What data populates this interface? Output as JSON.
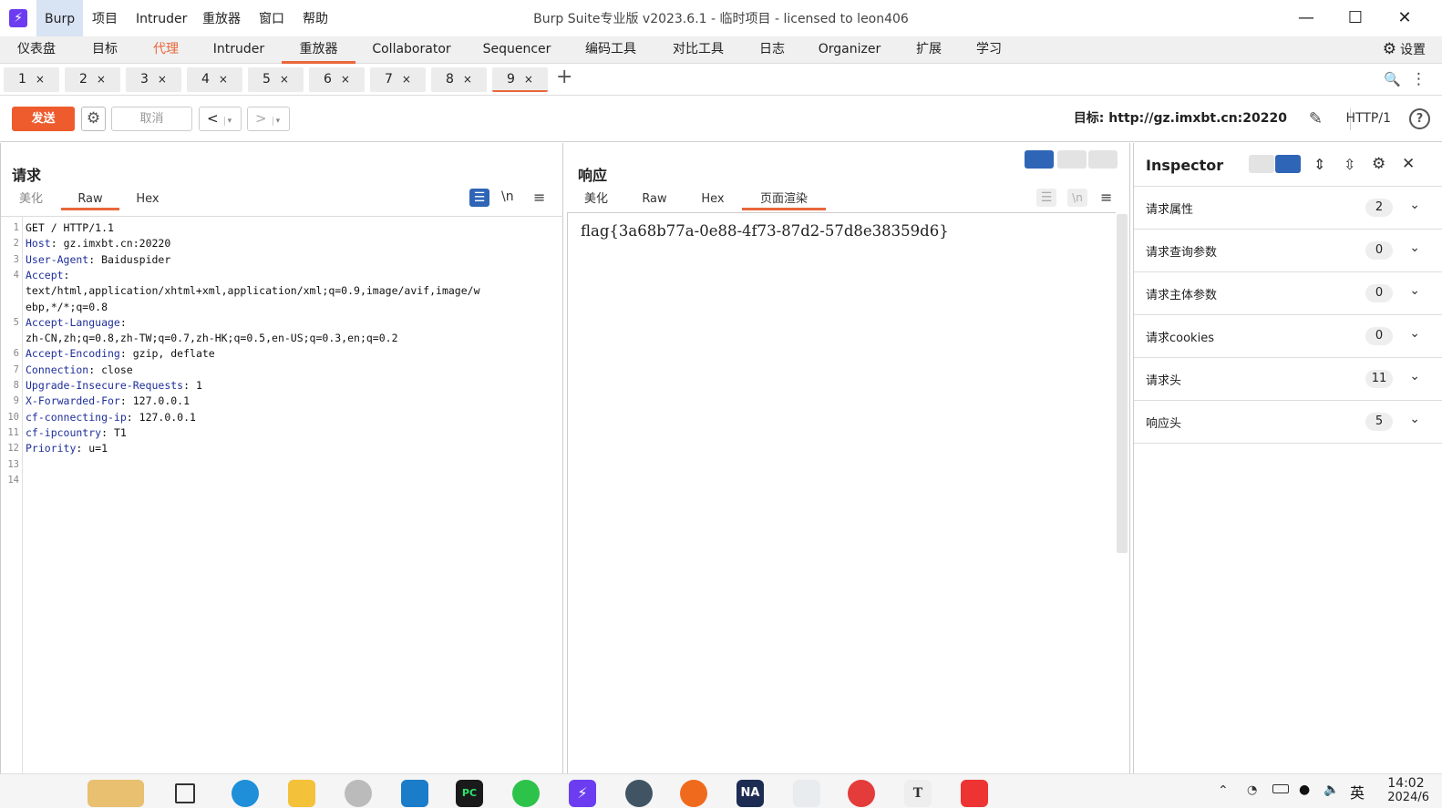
{
  "titlebar": {
    "app_logo": "⚡",
    "menu": [
      "Burp",
      "项目",
      "Intruder",
      "重放器",
      "窗口",
      "帮助"
    ],
    "window_title": "Burp Suite专业版  v2023.6.1 - 临时项目 - licensed to leon406",
    "minimize": "—",
    "maximize": "☐",
    "close": "✕"
  },
  "main_tabs": [
    "仪表盘",
    "目标",
    "代理",
    "Intruder",
    "重放器",
    "Collaborator",
    "Sequencer",
    "编码工具",
    "对比工具",
    "日志",
    "Organizer",
    "扩展",
    "学习"
  ],
  "settings_label": "设置",
  "settings_icon": "⚙",
  "repeater_tabs": [
    "1",
    "2",
    "3",
    "4",
    "5",
    "6",
    "7",
    "8",
    "9"
  ],
  "repeater_tab_close": "×",
  "add_tab": "+",
  "search_icon": "🔍",
  "more_icon": "⋮",
  "toolbar": {
    "send": "发送",
    "send_settings_icon": "⚙",
    "cancel": "取消",
    "back": "<",
    "forward": ">",
    "dropdown": "▾",
    "target_label": "目标: http://gz.imxbt.cn:20220",
    "edit_icon": "✎",
    "http_version": "HTTP/1",
    "help_icon": "?"
  },
  "request": {
    "title": "请求",
    "tabs": [
      "美化",
      "Raw",
      "Hex"
    ],
    "active_tab": "Raw",
    "tool_icons": [
      "☰",
      "\\n",
      "≡"
    ],
    "lines": [
      {
        "n": "1",
        "key": "",
        "val": "GET / HTTP/1.1"
      },
      {
        "n": "2",
        "key": "Host",
        "val": " gz.imxbt.cn:20220"
      },
      {
        "n": "3",
        "key": "User-Agent",
        "val": " Baiduspider"
      },
      {
        "n": "4",
        "key": "Accept",
        "val": ""
      },
      {
        "n": "",
        "key": "",
        "val": "text/html,application/xhtml+xml,application/xml;q=0.9,image/avif,image/w"
      },
      {
        "n": "",
        "key": "",
        "val": "ebp,*/*;q=0.8"
      },
      {
        "n": "5",
        "key": "Accept-Language",
        "val": ""
      },
      {
        "n": "",
        "key": "",
        "val": "zh-CN,zh;q=0.8,zh-TW;q=0.7,zh-HK;q=0.5,en-US;q=0.3,en;q=0.2"
      },
      {
        "n": "6",
        "key": "Accept-Encoding",
        "val": " gzip, deflate"
      },
      {
        "n": "7",
        "key": "Connection",
        "val": " close"
      },
      {
        "n": "8",
        "key": "Upgrade-Insecure-Requests",
        "val": " 1"
      },
      {
        "n": "9",
        "key": "X-Forwarded-For",
        "val": " 127.0.0.1"
      },
      {
        "n": "10",
        "key": "cf-connecting-ip",
        "val": " 127.0.0.1"
      },
      {
        "n": "11",
        "key": "cf-ipcountry",
        "val": " T1"
      },
      {
        "n": "12",
        "key": "Priority",
        "val": " u=1"
      },
      {
        "n": "13",
        "key": "",
        "val": ""
      },
      {
        "n": "14",
        "key": "",
        "val": ""
      }
    ]
  },
  "response": {
    "title": "响应",
    "tabs": [
      "美化",
      "Raw",
      "Hex",
      "页面渲染"
    ],
    "active_tab": "页面渲染",
    "tool_icons": [
      "☰",
      "\\n",
      "≡"
    ],
    "body": "flag{3a68b77a-0e88-4f73-87d2-57d8e38359d6}"
  },
  "inspector": {
    "title": "Inspector",
    "icons": [
      "⇕",
      "⇳",
      "⚙",
      "✕"
    ],
    "rows": [
      {
        "label": "请求属性",
        "count": "2"
      },
      {
        "label": "请求查询参数",
        "count": "0"
      },
      {
        "label": "请求主体参数",
        "count": "0"
      },
      {
        "label": "请求cookies",
        "count": "0"
      },
      {
        "label": "请求头",
        "count": "11"
      },
      {
        "label": "响应头",
        "count": "5"
      }
    ],
    "chevron": "⌄"
  },
  "taskbar": {
    "tray_ime": "英",
    "clock": "14:02",
    "date": "2024/6",
    "na_label": "NA",
    "pc_label": "PC",
    "t_label": "T"
  },
  "colors": {
    "accent": "#e9673b",
    "send_button": "#ee5b2c",
    "header_key": "#1f2f9a",
    "burp_logo": "#6c3df0",
    "layout_toggle_active": "#2f65b6"
  }
}
